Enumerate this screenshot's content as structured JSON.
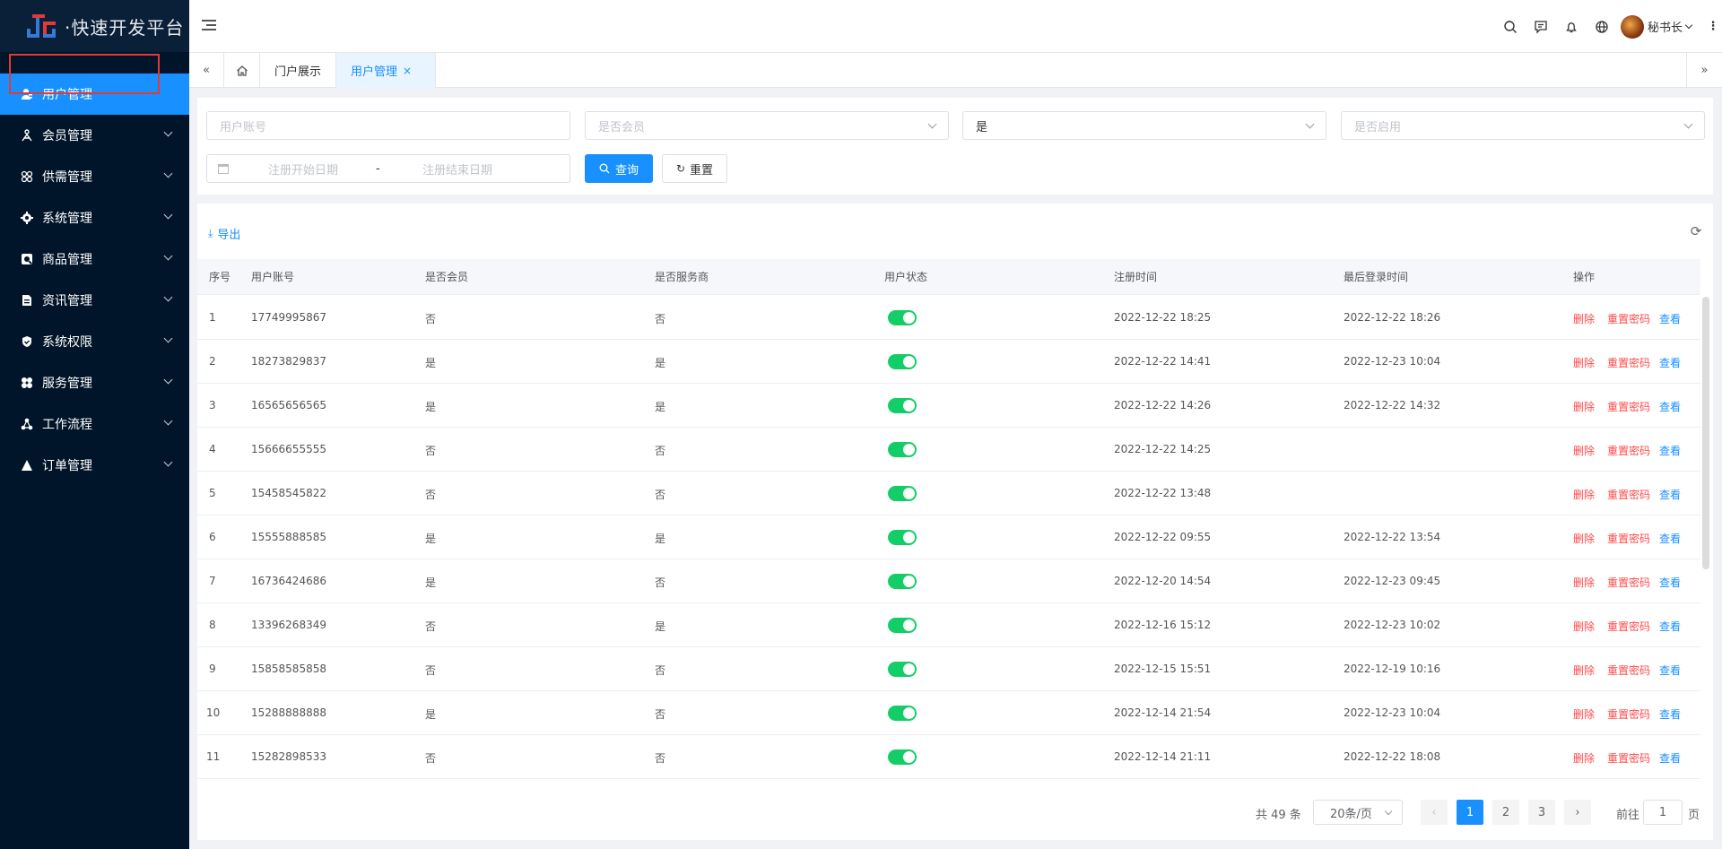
{
  "app": {
    "title": "·快速开发平台"
  },
  "sidebar": {
    "items": [
      {
        "label": "用户管理",
        "icon": "user-icon",
        "active": true
      },
      {
        "label": "会员管理",
        "icon": "members-icon"
      },
      {
        "label": "供需管理",
        "icon": "supply-icon"
      },
      {
        "label": "系统管理",
        "icon": "gear-icon"
      },
      {
        "label": "商品管理",
        "icon": "goods-icon"
      },
      {
        "label": "资讯管理",
        "icon": "news-icon"
      },
      {
        "label": "系统权限",
        "icon": "shield-icon"
      },
      {
        "label": "服务管理",
        "icon": "service-icon"
      },
      {
        "label": "工作流程",
        "icon": "workflow-icon"
      },
      {
        "label": "订单管理",
        "icon": "order-icon"
      }
    ]
  },
  "header": {
    "username": "秘书长"
  },
  "tabs": {
    "items": [
      {
        "label": "门户展示"
      },
      {
        "label": "用户管理",
        "active": true,
        "close": "×"
      }
    ]
  },
  "search": {
    "account_placeholder": "用户账号",
    "member_placeholder": "是否会员",
    "provider_value": "是",
    "enabled_placeholder": "是否启用",
    "start_date_placeholder": "注册开始日期",
    "date_separator": "-",
    "end_date_placeholder": "注册结束日期",
    "query_label": "查询",
    "reset_label": "重置"
  },
  "toolbar": {
    "export_label": "导出"
  },
  "table": {
    "headers": [
      "序号",
      "用户账号",
      "是否会员",
      "是否服务商",
      "用户状态",
      "注册时间",
      "最后登录时间",
      "操作"
    ],
    "actions": {
      "delete": "删除",
      "reset_password": "重置密码",
      "view": "查看"
    },
    "rows": [
      {
        "no": "1",
        "account": "17749995867",
        "member": "否",
        "provider": "否",
        "status": true,
        "registered": "2022-12-22 18:25",
        "last_login": "2022-12-22 18:26"
      },
      {
        "no": "2",
        "account": "18273829837",
        "member": "是",
        "provider": "是",
        "status": true,
        "registered": "2022-12-22 14:41",
        "last_login": "2022-12-23 10:04"
      },
      {
        "no": "3",
        "account": "16565656565",
        "member": "是",
        "provider": "是",
        "status": true,
        "registered": "2022-12-22 14:26",
        "last_login": "2022-12-22 14:32"
      },
      {
        "no": "4",
        "account": "15666655555",
        "member": "否",
        "provider": "否",
        "status": true,
        "registered": "2022-12-22 14:25",
        "last_login": ""
      },
      {
        "no": "5",
        "account": "15458545822",
        "member": "否",
        "provider": "否",
        "status": true,
        "registered": "2022-12-22 13:48",
        "last_login": ""
      },
      {
        "no": "6",
        "account": "15555888585",
        "member": "是",
        "provider": "是",
        "status": true,
        "registered": "2022-12-22 09:55",
        "last_login": "2022-12-22 13:54"
      },
      {
        "no": "7",
        "account": "16736424686",
        "member": "是",
        "provider": "否",
        "status": true,
        "registered": "2022-12-20 14:54",
        "last_login": "2022-12-23 09:45"
      },
      {
        "no": "8",
        "account": "13396268349",
        "member": "否",
        "provider": "是",
        "status": true,
        "registered": "2022-12-16 15:12",
        "last_login": "2022-12-23 10:02"
      },
      {
        "no": "9",
        "account": "15858585858",
        "member": "否",
        "provider": "否",
        "status": true,
        "registered": "2022-12-15 15:51",
        "last_login": "2022-12-19 10:16"
      },
      {
        "no": "10",
        "account": "15288888888",
        "member": "是",
        "provider": "否",
        "status": true,
        "registered": "2022-12-14 21:54",
        "last_login": "2022-12-23 10:04"
      },
      {
        "no": "11",
        "account": "15282898533",
        "member": "否",
        "provider": "否",
        "status": true,
        "registered": "2022-12-14 21:11",
        "last_login": "2022-12-22 18:08"
      }
    ]
  },
  "pagination": {
    "total": "共 49 条",
    "page_size": "20条/页",
    "pages": [
      "1",
      "2",
      "3"
    ],
    "goto_label": "前往",
    "goto_value": "1",
    "page_unit": "页"
  },
  "colors": {
    "primary": "#1890ff",
    "sidebar": "#001529",
    "danger": "#ff4949",
    "switch_on": "#13ce66"
  }
}
